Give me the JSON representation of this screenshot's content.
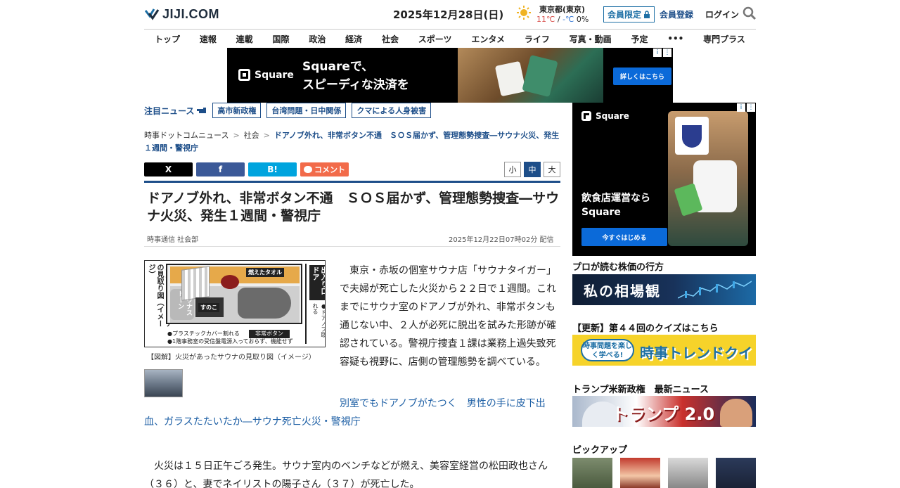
{
  "header": {
    "logo": "JIJI.COM",
    "date": "2025年12月28日(日)",
    "weather": {
      "place": "東京都(東京)",
      "high": "11℃",
      "low": "-℃",
      "precip": "0%",
      "icon": "sun-icon"
    },
    "members_only": "会員限定",
    "register": "会員登録",
    "login": "ログイン"
  },
  "nav": [
    "トップ",
    "速報",
    "連載",
    "国際",
    "政治",
    "経済",
    "社会",
    "スポーツ",
    "エンタメ",
    "ライフ",
    "写真・動画",
    "予定",
    "•••",
    "専門プラス"
  ],
  "top_ad": {
    "brand": "Square",
    "line1": "Squareで、",
    "line2": "スピーディな決済を",
    "cta": "詳しくはこちら"
  },
  "hot_news": {
    "label": "注目ニュース",
    "tags": [
      "高市新政権",
      "台湾問題・日中関係",
      "クマによる人身被害"
    ]
  },
  "breadcrumb": {
    "root": "時事ドットコムニュース",
    "section": "社会",
    "current": "ドアノブ外れ、非常ボタン不通　ＳＯＳ届かず、管理態勢捜査―サウナ火災、発生１週間・警視庁"
  },
  "share": {
    "x": "X",
    "facebook": "f",
    "hatena": "B!",
    "comment": "コメント"
  },
  "font_size": [
    "小",
    "中",
    "大"
  ],
  "article": {
    "headline": "ドアノブ外れ、非常ボタン不通　ＳＯＳ届かず、管理態勢捜査―サウナ火災、発生１週間・警視庁",
    "source": "時事通信 社会部",
    "published": "2025年12月22日07時02分 配信",
    "figure": {
      "title": "火災があったサウナの見取り図（イメージ）",
      "door_label": "出入り口ドア",
      "door_note": "●たたいた跡 ●ドアノブ取れる",
      "towel": "燃えたタオル",
      "stone": "サウナストーン",
      "mat": "すのこ",
      "note1": "●プラスチックカバー割れる",
      "note2": "●1階事務室の受信盤電源入っておらず、機能せず",
      "button": "非常ボタン"
    },
    "caption": "【図解】火災があったサウナの見取り図（イメージ）",
    "lead": "東京・赤坂の個室サウナ店「サウナタイガー」で夫婦が死亡した火災から２２日で１週間。これまでにサウナ室のドアノブが外れ、非常ボタンも通じない中、２人が必死に脱出を試みた形跡が確認されている。警視庁捜査１課は業務上過失致死容疑も視野に、店側の管理態勢を調べている。",
    "related": "別室でもドアノブがたつく　男性の手に皮下出血、ガラスたたいたか―サウナ死亡火災・警視庁",
    "body": "火災は１５日正午ごろ発生。サウナ室内のベンチなどが燃え、美容室経営の松田政也さん（３６）と、妻でネイリストの陽子さん（３７）が死亡した。"
  },
  "side_ad": {
    "brand": "Square",
    "copy1": "飲食店運営なら",
    "copy2": "Square",
    "cta": "今すぐはじめる"
  },
  "sidebar": {
    "section1": {
      "title": "プロが読む株価の行方",
      "banner_text": "私の相場観"
    },
    "section2": {
      "title": "【更新】第４４回のクイズはこちら",
      "pill": "時事問題を楽しく学べる!",
      "banner_text": "時事トレンドクイズ"
    },
    "section3": {
      "title": "トランプ米新政権　最新ニュース",
      "banner_text": "トランプ 2.0"
    },
    "section4": {
      "title": "ピックアップ"
    }
  },
  "colors": {
    "brand_blue": "#1d4e89",
    "link_blue": "#1d5fa5",
    "comment_orange": "#f26b4a",
    "ad_cta": "#0b6ad9"
  }
}
